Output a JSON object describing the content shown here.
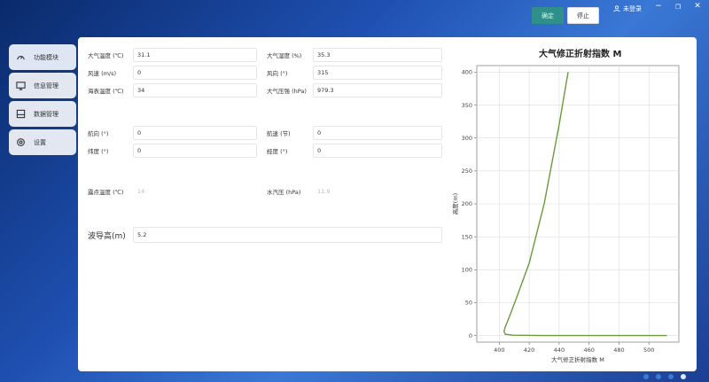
{
  "topbar": {
    "confirm_label": "确定",
    "stop_label": "停止",
    "user_name": "未登录",
    "controls": [
      "−",
      "❐",
      "✕"
    ]
  },
  "sidebar": {
    "items": [
      {
        "label": "功能模块",
        "icon": "gauge-icon"
      },
      {
        "label": "信息管理",
        "icon": "monitor-icon"
      },
      {
        "label": "数据管理",
        "icon": "database-icon"
      },
      {
        "label": "设置",
        "icon": "gear-icon"
      }
    ]
  },
  "form": {
    "air_temp": {
      "label": "大气温度 (℃)",
      "value": "31.1"
    },
    "humidity": {
      "label": "大气湿度 (%)",
      "value": "35.3"
    },
    "wind_speed": {
      "label": "风速 (m/s)",
      "value": "0"
    },
    "wind_dir": {
      "label": "风向 (°)",
      "value": "315"
    },
    "sea_temp": {
      "label": "海表温度 (℃)",
      "value": "34"
    },
    "pressure": {
      "label": "大气压强 (hPa)",
      "value": "979.3"
    },
    "heading": {
      "label": "航向 (°)",
      "value": "0"
    },
    "speed": {
      "label": "航速 (节)",
      "value": "0"
    },
    "latitude": {
      "label": "纬度 (°)",
      "value": "0"
    },
    "longitude": {
      "label": "经度 (°)",
      "value": "0"
    },
    "dew_point": {
      "label": "露点温度 (℃)",
      "value": "14"
    },
    "vapor_pressure": {
      "label": "水汽压 (hPa)",
      "value": "11.9"
    },
    "wave_height": {
      "label": "波导高(m)",
      "value": "5.2"
    }
  },
  "chart_data": {
    "type": "line",
    "title": "大气修正折射指数 M",
    "xlabel": "大气修正折射指数 M",
    "ylabel": "高度(m)",
    "xlim": [
      385,
      520
    ],
    "ylim": [
      -10,
      410
    ],
    "xticks": [
      400,
      420,
      440,
      460,
      480,
      500
    ],
    "yticks": [
      0,
      50,
      100,
      150,
      200,
      250,
      300,
      350,
      400
    ],
    "grid": true,
    "series": [
      {
        "color": "#6b9a3c",
        "x": [
          512,
          470,
          430,
          409,
          404,
          403.2,
          403.8,
          407,
          412,
          420,
          430,
          440,
          446
        ],
        "y": [
          0,
          0,
          0,
          0.5,
          2,
          6,
          12,
          30,
          60,
          110,
          200,
          320,
          400
        ]
      }
    ]
  },
  "pagination": {
    "count": 4,
    "active": 3
  }
}
